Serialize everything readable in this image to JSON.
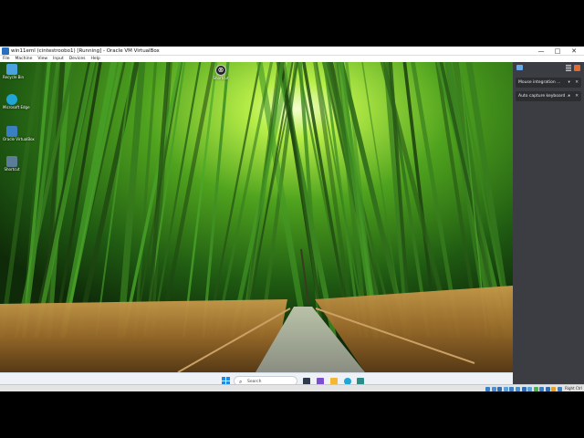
{
  "window": {
    "title": "win11eml (cintestroobo1) [Running] - Oracle VM VirtualBox",
    "controls": {
      "minimize": "—",
      "maximize": "□",
      "close": "✕"
    }
  },
  "menu": [
    "File",
    "Machine",
    "View",
    "Input",
    "Devices",
    "Help"
  ],
  "desktop": {
    "icons": [
      {
        "label": "Recycle Bin",
        "icon": "recycle-bin-icon",
        "color": "#4aa3e0"
      },
      {
        "label": "Microsoft Edge",
        "icon": "edge-icon",
        "color": "#1fa5d6"
      },
      {
        "label": "Oracle VirtualBox",
        "icon": "virtualbox-icon",
        "color": "#3a7fc1"
      },
      {
        "label": "Shortcut",
        "icon": "shortcut-icon",
        "color": "#5b7d98"
      }
    ],
    "top_icon": {
      "label": "Shortcut",
      "icon": "app-shortcut-icon"
    }
  },
  "taskbar": {
    "search_placeholder": "Search",
    "apps": [
      {
        "icon": "task-view-icon",
        "color": "#2f3b4b"
      },
      {
        "icon": "widgets-icon",
        "color": "#7d4fd0"
      },
      {
        "icon": "file-explorer-icon",
        "color": "#f2b834"
      },
      {
        "icon": "edge-icon",
        "color": "#1fa5d6"
      },
      {
        "icon": "store-icon",
        "color": "#2d8c8a"
      }
    ]
  },
  "side_panel": {
    "rows": [
      {
        "label": "Mouse integration ...",
        "controls": [
          "▾",
          "✕"
        ]
      },
      {
        "label": "Auto capture keyboard ...",
        "controls": [
          "▾",
          "✕"
        ]
      }
    ]
  },
  "statusbar": {
    "icon_colors": [
      "#3a7fc1",
      "#4a90d0",
      "#2f6fb0",
      "#5aa0d8",
      "#3a7fc1",
      "#4a90d0",
      "#2f6fb0",
      "#5aa0d8",
      "#49b04f",
      "#3a7fc1",
      "#2f6fb0",
      "#e0a030",
      "#3a7fc1"
    ],
    "host_key": "Right Ctrl"
  }
}
